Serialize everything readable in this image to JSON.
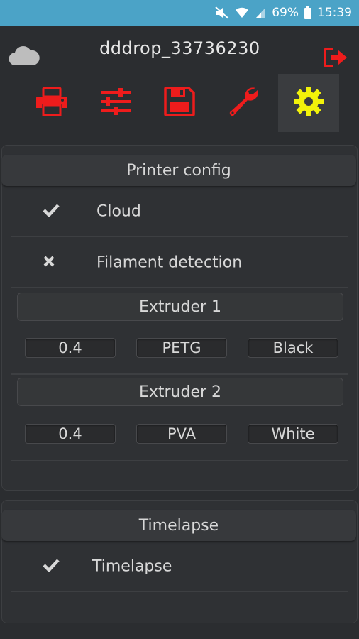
{
  "status_bar": {
    "battery": "69%",
    "time": "15:39",
    "bg_color": "#4ba3c7"
  },
  "header": {
    "device_name": "dddrop_33736230",
    "icons": {
      "cloud": "cloud-icon",
      "logout": "logout-icon"
    },
    "tabs": [
      {
        "icon": "printer-icon",
        "active": false
      },
      {
        "icon": "sliders-icon",
        "active": false
      },
      {
        "icon": "save-icon",
        "active": false
      },
      {
        "icon": "wrench-icon",
        "active": false
      },
      {
        "icon": "gear-icon",
        "active": true
      }
    ],
    "colors": {
      "icon_red": "#ee1c1c",
      "icon_active": "#f2f20a"
    }
  },
  "printer_config": {
    "title": "Printer config",
    "items": [
      {
        "label": "Cloud",
        "state": "checked",
        "icon": "check-icon"
      },
      {
        "label": "Filament detection",
        "state": "unchecked",
        "icon": "cross-icon"
      }
    ],
    "extruders": [
      {
        "title": "Extruder 1",
        "nozzle": "0.4",
        "material": "PETG",
        "color": "Black"
      },
      {
        "title": "Extruder 2",
        "nozzle": "0.4",
        "material": "PVA",
        "color": "White"
      }
    ]
  },
  "timelapse": {
    "title": "Timelapse",
    "items": [
      {
        "label": "Timelapse",
        "state": "checked",
        "icon": "check-icon"
      }
    ]
  }
}
